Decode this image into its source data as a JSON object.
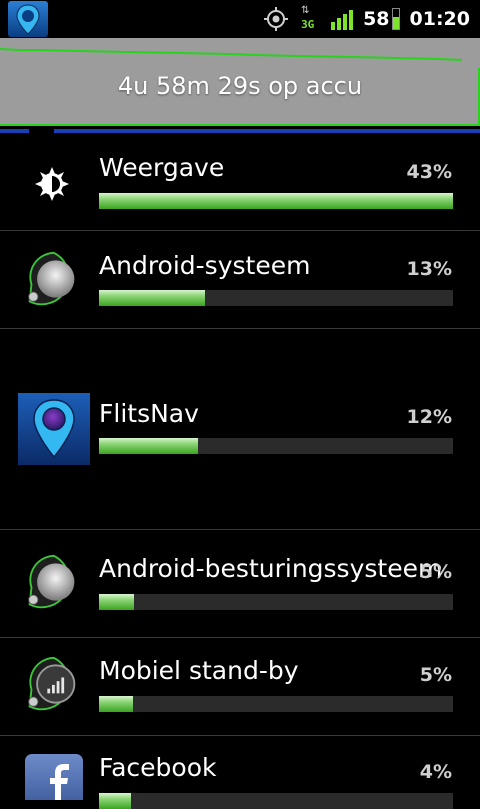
{
  "status_bar": {
    "app_icon": "flitsnav-icon",
    "gps_icon": "gps-icon",
    "network_label": "3G",
    "battery_level": "58",
    "time": "01:20"
  },
  "header": {
    "remaining": "4u 58m 29s op accu"
  },
  "items": [
    {
      "name": "Weergave",
      "percent": "43%",
      "fraction": 1.0,
      "icon": "display-brightness-icon"
    },
    {
      "name": "Android-systeem",
      "percent": "13%",
      "fraction": 0.3,
      "icon": "android-system-icon"
    },
    {
      "name": "FlitsNav",
      "percent": "12%",
      "fraction": 0.28,
      "icon": "flitsnav-icon"
    },
    {
      "name": "Android-besturingssysteem",
      "percent": "5%",
      "fraction": 0.1,
      "icon": "android-os-icon"
    },
    {
      "name": "Mobiel stand-by",
      "percent": "5%",
      "fraction": 0.095,
      "icon": "mobile-standby-icon"
    },
    {
      "name": "Facebook",
      "percent": "4%",
      "fraction": 0.09,
      "icon": "facebook-icon"
    }
  ],
  "colors": {
    "bar_green": "#3aa41f",
    "graph_bg": "#9c9c9c",
    "graph_line": "#28d21e",
    "divider_blue": "#1a3fb4"
  }
}
